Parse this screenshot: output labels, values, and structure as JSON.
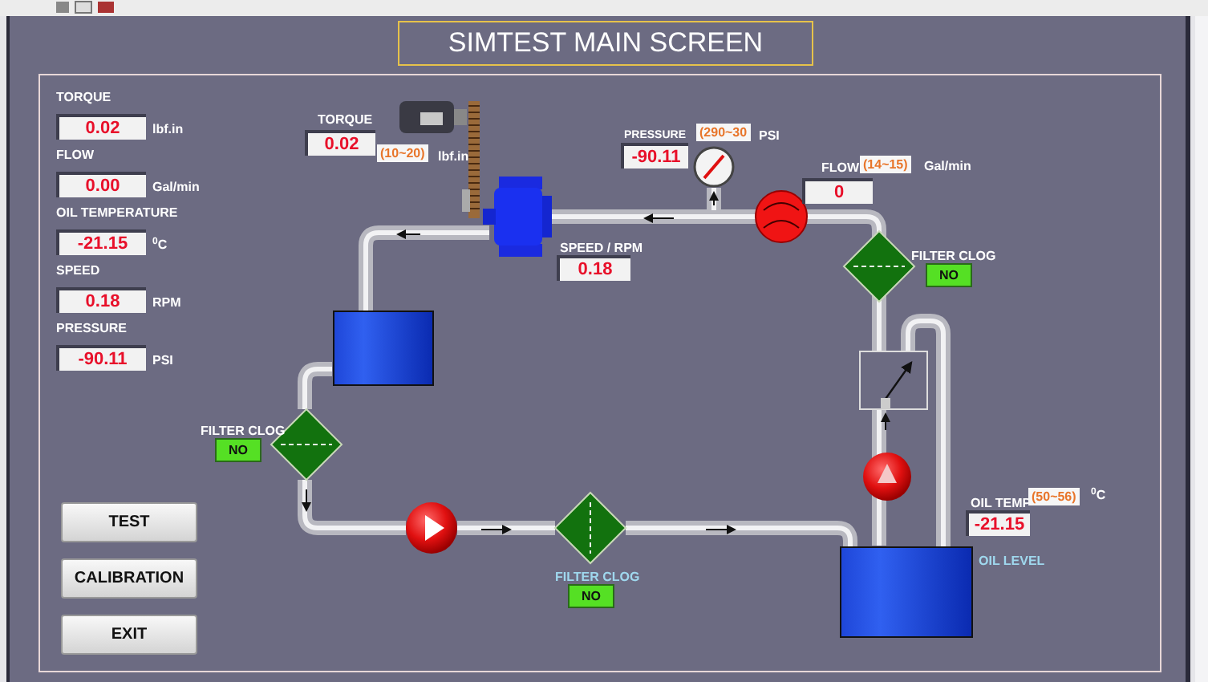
{
  "title": "SIMTEST MAIN SCREEN",
  "readouts": [
    {
      "label": "TORQUE",
      "value": "0.02",
      "unit": "lbf.in"
    },
    {
      "label": "FLOW",
      "value": "0.00",
      "unit": "Gal/min"
    },
    {
      "label": "OIL TEMPERATURE",
      "value": "-21.15",
      "unit": "$^{0}$C"
    },
    {
      "label": "SPEED",
      "value": "0.18",
      "unit": "RPM"
    },
    {
      "label": "PRESSURE",
      "value": "-90.11",
      "unit": "PSI"
    }
  ],
  "buttons": [
    "TEST",
    "CALIBRATION",
    "EXIT"
  ],
  "diagram": {
    "torque": {
      "label": "TORQUE",
      "value": "0.02",
      "range": "(10~20)",
      "unit": "lbf.in"
    },
    "pressure": {
      "label": "PRESSURE",
      "value": "-90.11",
      "range": "(290~30",
      "unit": "PSI"
    },
    "flow": {
      "label": "FLOW",
      "value": "0",
      "range": "(14~15)",
      "unit": "Gal/min"
    },
    "speed": {
      "label": "SPEED / RPM",
      "value": "0.18"
    },
    "oil_temp": {
      "label": "OIL TEMP",
      "value": "-21.15",
      "range": "(50~56)",
      "unit": "$^{0}$C"
    },
    "oil_level_label": "OIL LEVEL",
    "filters": [
      {
        "label": "FILTER CLOG",
        "status": "NO",
        "clogged": false
      },
      {
        "label": "FILTER CLOG",
        "status": "NO",
        "clogged": false
      },
      {
        "label": "FILTER CLOG",
        "status": "NO",
        "clogged": false
      }
    ]
  }
}
